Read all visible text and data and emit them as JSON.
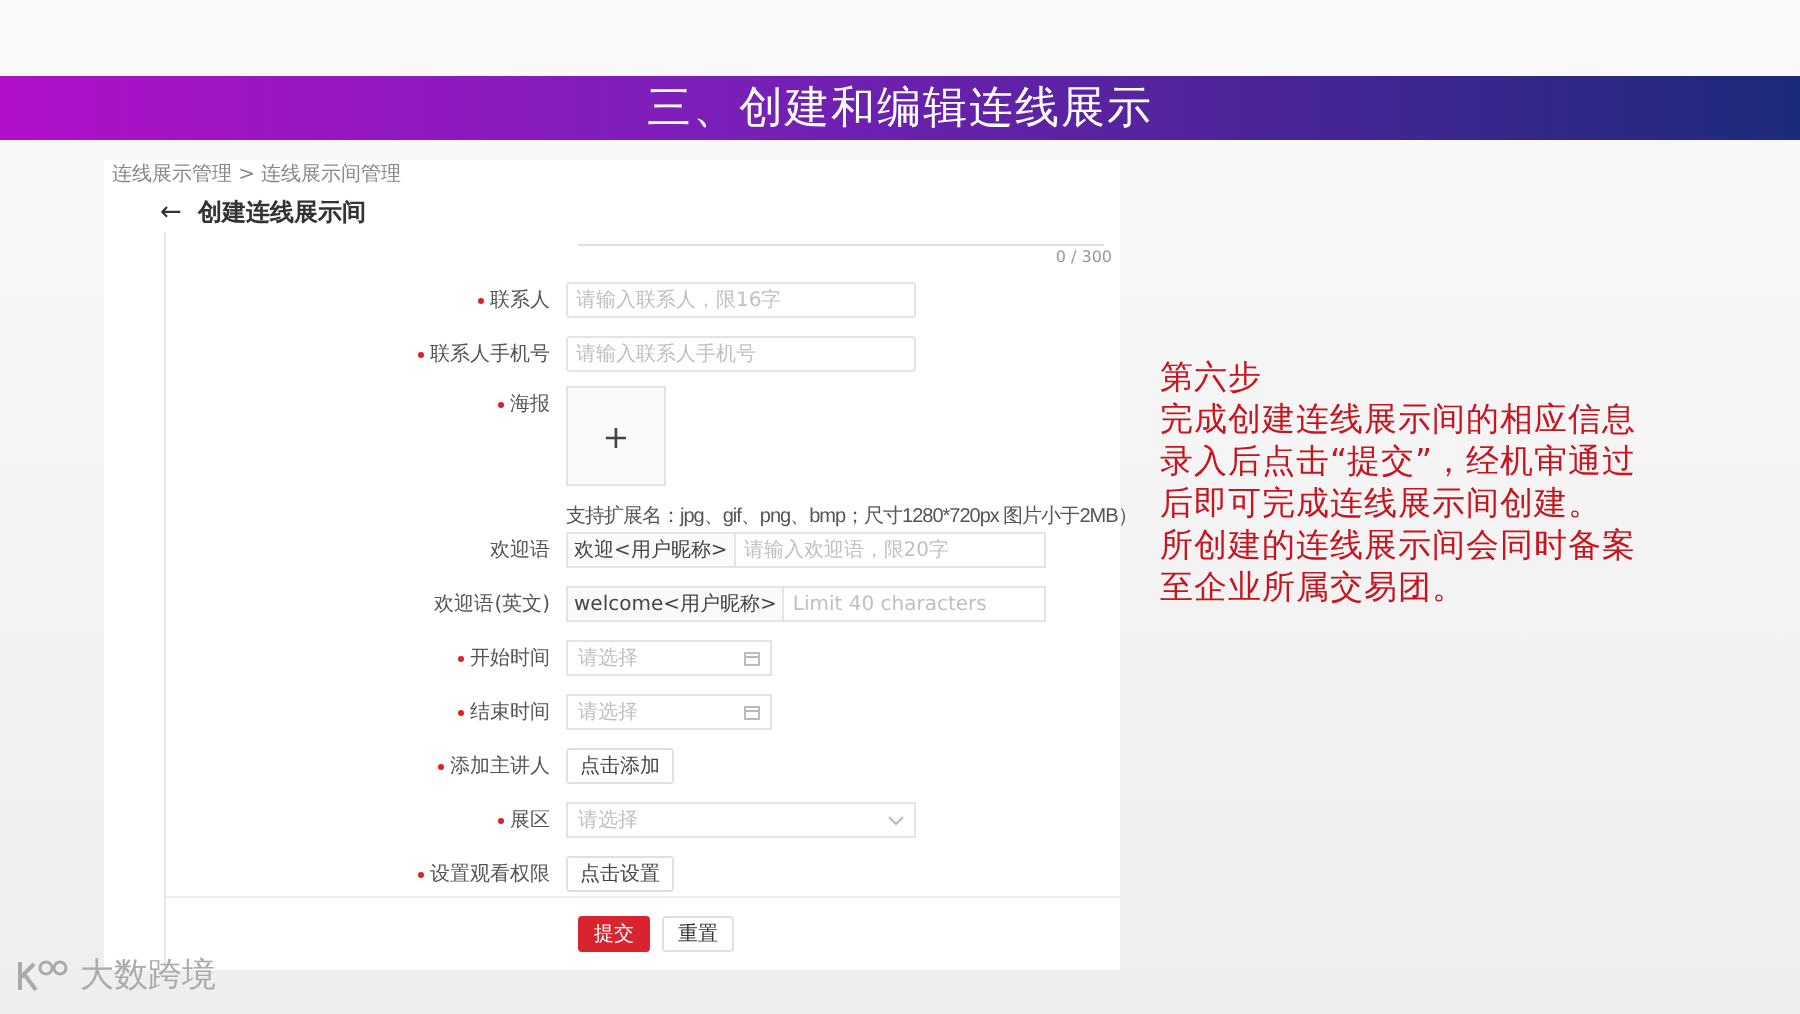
{
  "slide_title": "三、创建和编辑连线展示",
  "breadcrumb": "连线展示管理 > 连线展示间管理",
  "page_title": "创建连线展示间",
  "back_icon": "←",
  "counter": "0 / 300",
  "fields": [
    {
      "kind": "input",
      "label": "联系人",
      "required": true,
      "placeholder": "请输入联系人，限16字"
    },
    {
      "kind": "input",
      "label": "联系人手机号",
      "required": true,
      "placeholder": "请输入联系人手机号"
    },
    {
      "kind": "upload",
      "label": "海报",
      "required": true,
      "icon": "+",
      "hint": "支持扩展名：jpg、gif、png、bmp；尺寸1280*720px 图片小于2MB）"
    },
    {
      "kind": "addon",
      "label": "欢迎语",
      "required": false,
      "addon": "欢迎<用户昵称>",
      "placeholder": "请输入欢迎语，限20字"
    },
    {
      "kind": "addon",
      "label": "欢迎语(英文)",
      "required": false,
      "addon": "welcome<用户昵称>",
      "placeholder": "Limit 40 characters"
    },
    {
      "kind": "date",
      "label": "开始时间",
      "required": true,
      "placeholder": "请选择"
    },
    {
      "kind": "date",
      "label": "结束时间",
      "required": true,
      "placeholder": "请选择"
    },
    {
      "kind": "button",
      "label": "添加主讲人",
      "required": true,
      "button": "点击添加"
    },
    {
      "kind": "select",
      "label": "展区",
      "required": true,
      "placeholder": "请选择"
    },
    {
      "kind": "button",
      "label": "设置观看权限",
      "required": true,
      "button": "点击设置"
    }
  ],
  "buttons": [
    {
      "label": "提交",
      "primary": true
    },
    {
      "label": "重置",
      "primary": false
    }
  ],
  "step": {
    "title": "第六步",
    "paragraphs": [
      "完成创建连线展示间的相应信息录入后点击“提交”，经机审通过后即可完成连线展示间创建。",
      "所创建的连线展示间会同时备案至企业所属交易团。"
    ]
  },
  "logo_text": "大数跨境"
}
